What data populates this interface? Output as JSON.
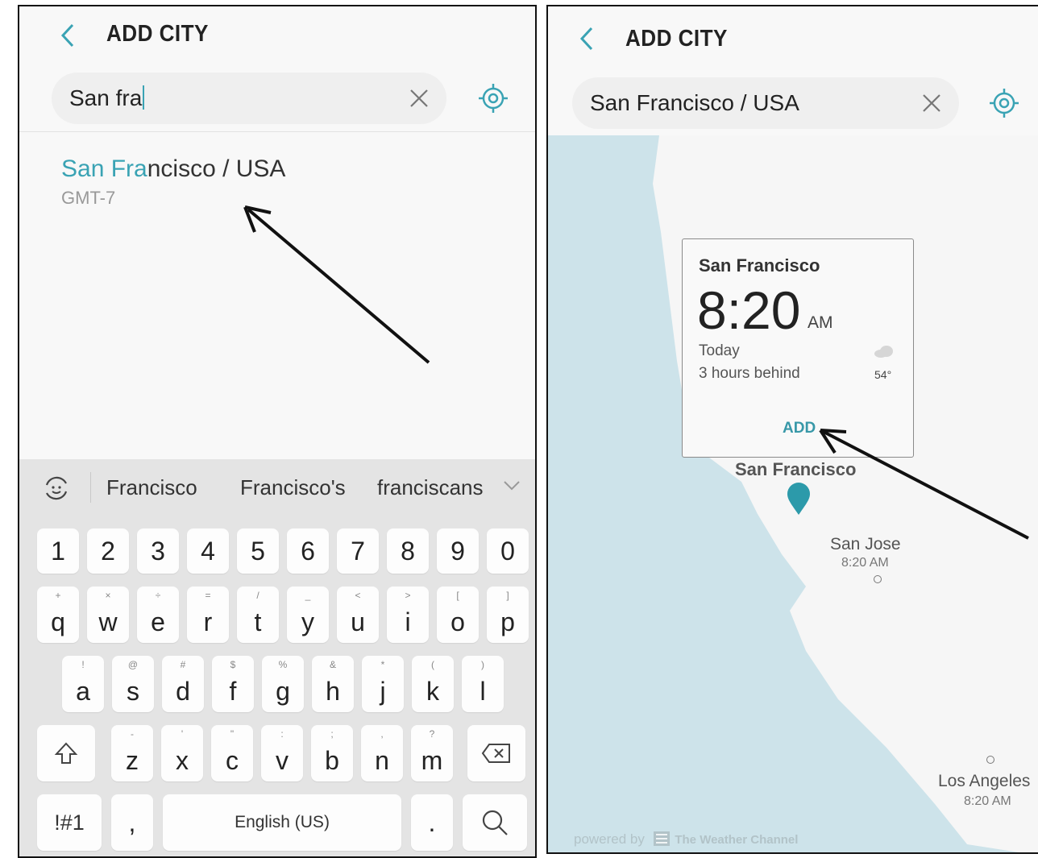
{
  "left": {
    "header_title": "ADD CITY",
    "search_value": "San fra",
    "result": {
      "match": "San Fra",
      "rest": "ncisco / USA",
      "gmt": "GMT-7"
    },
    "suggestions": [
      "Francisco",
      "Francisco's",
      "franciscans"
    ],
    "keyboard": {
      "numbers": [
        "1",
        "2",
        "3",
        "4",
        "5",
        "6",
        "7",
        "8",
        "9",
        "0"
      ],
      "row1": [
        {
          "k": "q",
          "h": "+"
        },
        {
          "k": "w",
          "h": "×"
        },
        {
          "k": "e",
          "h": "÷"
        },
        {
          "k": "r",
          "h": "="
        },
        {
          "k": "t",
          "h": "/"
        },
        {
          "k": "y",
          "h": "_"
        },
        {
          "k": "u",
          "h": "<"
        },
        {
          "k": "i",
          "h": ">"
        },
        {
          "k": "o",
          "h": "["
        },
        {
          "k": "p",
          "h": "]"
        }
      ],
      "row2": [
        {
          "k": "a",
          "h": "!"
        },
        {
          "k": "s",
          "h": "@"
        },
        {
          "k": "d",
          "h": "#"
        },
        {
          "k": "f",
          "h": "$"
        },
        {
          "k": "g",
          "h": "%"
        },
        {
          "k": "h",
          "h": "&"
        },
        {
          "k": "j",
          "h": "*"
        },
        {
          "k": "k",
          "h": "("
        },
        {
          "k": "l",
          "h": ")"
        }
      ],
      "row3": [
        {
          "k": "z",
          "h": "-"
        },
        {
          "k": "x",
          "h": "'"
        },
        {
          "k": "c",
          "h": "\""
        },
        {
          "k": "v",
          "h": ":"
        },
        {
          "k": "b",
          "h": ";"
        },
        {
          "k": "n",
          "h": ","
        },
        {
          "k": "m",
          "h": "?"
        }
      ],
      "symbols_label": "!#1",
      "comma": ",",
      "space_label": "English (US)",
      "period": "."
    }
  },
  "right": {
    "header_title": "ADD CITY",
    "search_value": "San Francisco / USA",
    "card": {
      "city": "San Francisco",
      "time": "8:20",
      "ampm": "AM",
      "day": "Today",
      "behind": "3 hours behind",
      "temp": "54°",
      "add_label": "ADD"
    },
    "map_labels": {
      "sf": "San Francisco",
      "sj": "San Jose",
      "sj_time": "8:20 AM",
      "la": "Los Angeles",
      "la_time": "8:20 AM"
    },
    "footer_powered": "powered by",
    "footer_brand": "The Weather Channel"
  },
  "colors": {
    "accent": "#3aa3b4",
    "map_water": "#cde3ea",
    "map_land": "#f6f6f6",
    "pin": "#2c9aaa"
  }
}
